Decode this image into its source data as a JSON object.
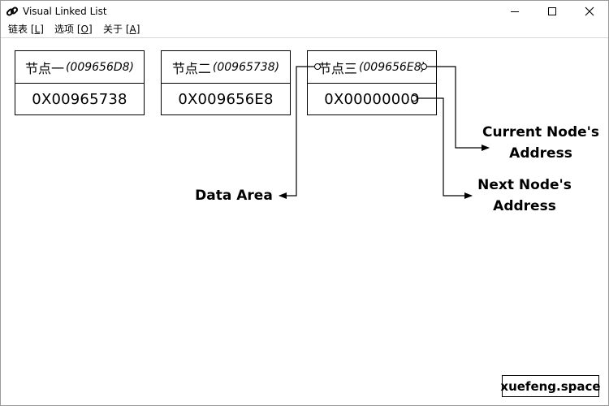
{
  "window": {
    "title": "Visual Linked List"
  },
  "menu": [
    {
      "label": "链表 ",
      "key": "[L]"
    },
    {
      "label": "选项 ",
      "key": "[O]"
    },
    {
      "label": "关于 ",
      "key": "[A]"
    }
  ],
  "nodes": [
    {
      "name": "节点一",
      "address": "(009656D8)",
      "next": "0X00965738"
    },
    {
      "name": "节点二",
      "address": "(00965738)",
      "next": "0X009656E8"
    },
    {
      "name": "节点三",
      "address": "(009656E8)",
      "next": "0X00000000"
    }
  ],
  "annotations": {
    "current_line1": "Current Node's",
    "current_line2": "Address",
    "next_line1": "Next Node's",
    "next_line2": "Address",
    "data_area": "Data Area"
  },
  "watermark": "xuefeng.space"
}
